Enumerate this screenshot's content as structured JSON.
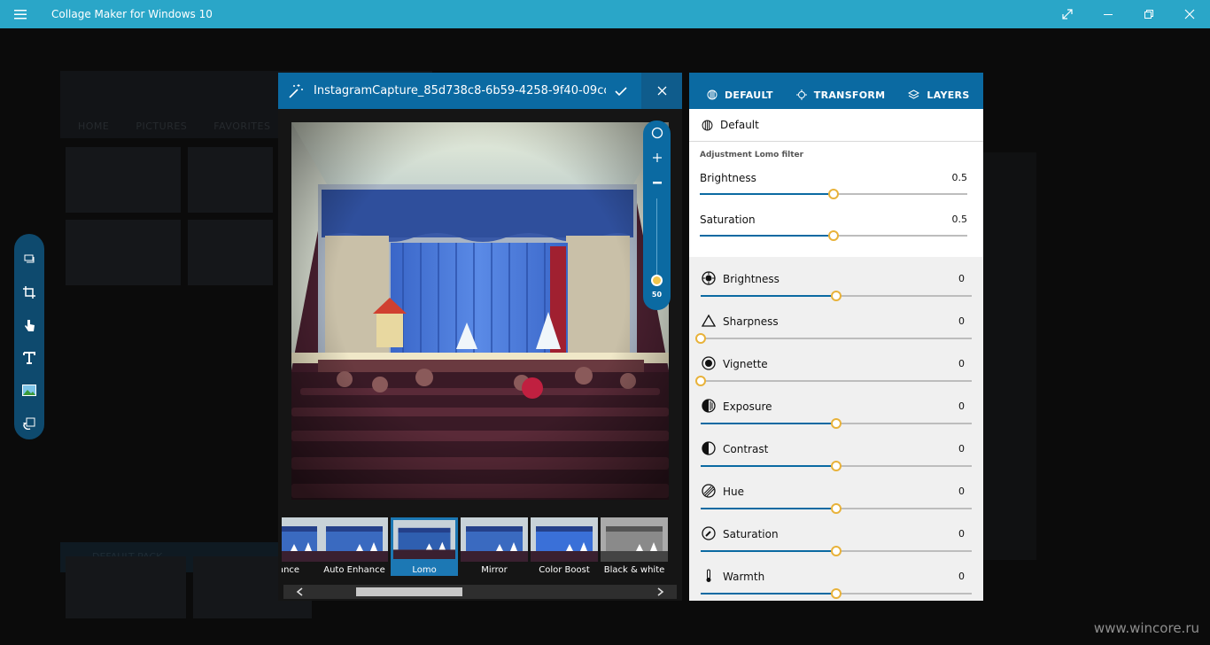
{
  "app": {
    "title": "Collage Maker for Windows 10"
  },
  "background": {
    "tabs": [
      "HOME",
      "PICTURES",
      "FAVORITES"
    ],
    "pack_label": "DEFAULT PACK"
  },
  "editor": {
    "filename": "InstagramCapture_85d738c8-6b59-4258-9f40-09ccb...",
    "zoom_value": "50",
    "filters": [
      {
        "label": "ance",
        "active": false
      },
      {
        "label": "Auto Enhance",
        "active": false
      },
      {
        "label": "Lomo",
        "active": true
      },
      {
        "label": "Mirror",
        "active": false
      },
      {
        "label": "Color Boost",
        "active": false
      },
      {
        "label": "Black & white",
        "active": false
      }
    ]
  },
  "panel": {
    "tabs": [
      "DEFAULT",
      "TRANSFORM",
      "LAYERS"
    ],
    "preset": "Default",
    "filter_heading": "Adjustment Lomo filter",
    "filter_sliders": [
      {
        "label": "Brightness",
        "value": "0.5",
        "fraction": 0.5
      },
      {
        "label": "Saturation",
        "value": "0.5",
        "fraction": 0.5
      }
    ],
    "adjustments": [
      {
        "label": "Brightness",
        "value": "0",
        "fraction": 0.5,
        "icon": "brightness-icon"
      },
      {
        "label": "Sharpness",
        "value": "0",
        "fraction": 0.0,
        "icon": "sharpness-icon"
      },
      {
        "label": "Vignette",
        "value": "0",
        "fraction": 0.0,
        "icon": "vignette-icon"
      },
      {
        "label": "Exposure",
        "value": "0",
        "fraction": 0.5,
        "icon": "exposure-icon"
      },
      {
        "label": "Contrast",
        "value": "0",
        "fraction": 0.5,
        "icon": "contrast-icon"
      },
      {
        "label": "Hue",
        "value": "0",
        "fraction": 0.5,
        "icon": "hue-icon"
      },
      {
        "label": "Saturation",
        "value": "0",
        "fraction": 0.5,
        "icon": "saturation-icon"
      },
      {
        "label": "Warmth",
        "value": "0",
        "fraction": 0.5,
        "icon": "warmth-icon"
      }
    ]
  },
  "watermark": "www.wincore.ru",
  "colors": {
    "titlebar": "#2aa6c8",
    "accent": "#0b6aa2",
    "slider_knob": "#e8b23a"
  }
}
